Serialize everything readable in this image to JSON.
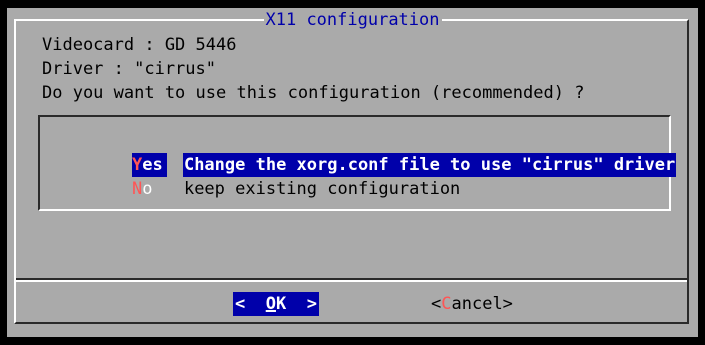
{
  "dialog": {
    "title": "X11 configuration",
    "videocard_line": "Videocard : GD 5446",
    "driver_line": "Driver : \"cirrus\"",
    "question": "Do you want to use this configuration (recommended) ?"
  },
  "menu": {
    "items": [
      {
        "tag_hot": "Y",
        "tag_rest": "es",
        "description": "Change the xorg.conf file to use \"cirrus\" driver",
        "selected": true
      },
      {
        "tag_hot": "N",
        "tag_rest": "o",
        "description": "keep existing configuration",
        "selected": false
      }
    ]
  },
  "buttons": {
    "ok": {
      "left": "<  ",
      "hot": "O",
      "rest": "K",
      "right": "  >"
    },
    "cancel": {
      "left": "<",
      "hot": "C",
      "rest": "ancel>"
    }
  },
  "colors": {
    "background": "#aaaaaa",
    "screen": "#000000",
    "highlight": "#0000aa",
    "hotkey": "#ff5555",
    "title": "#0000aa"
  }
}
